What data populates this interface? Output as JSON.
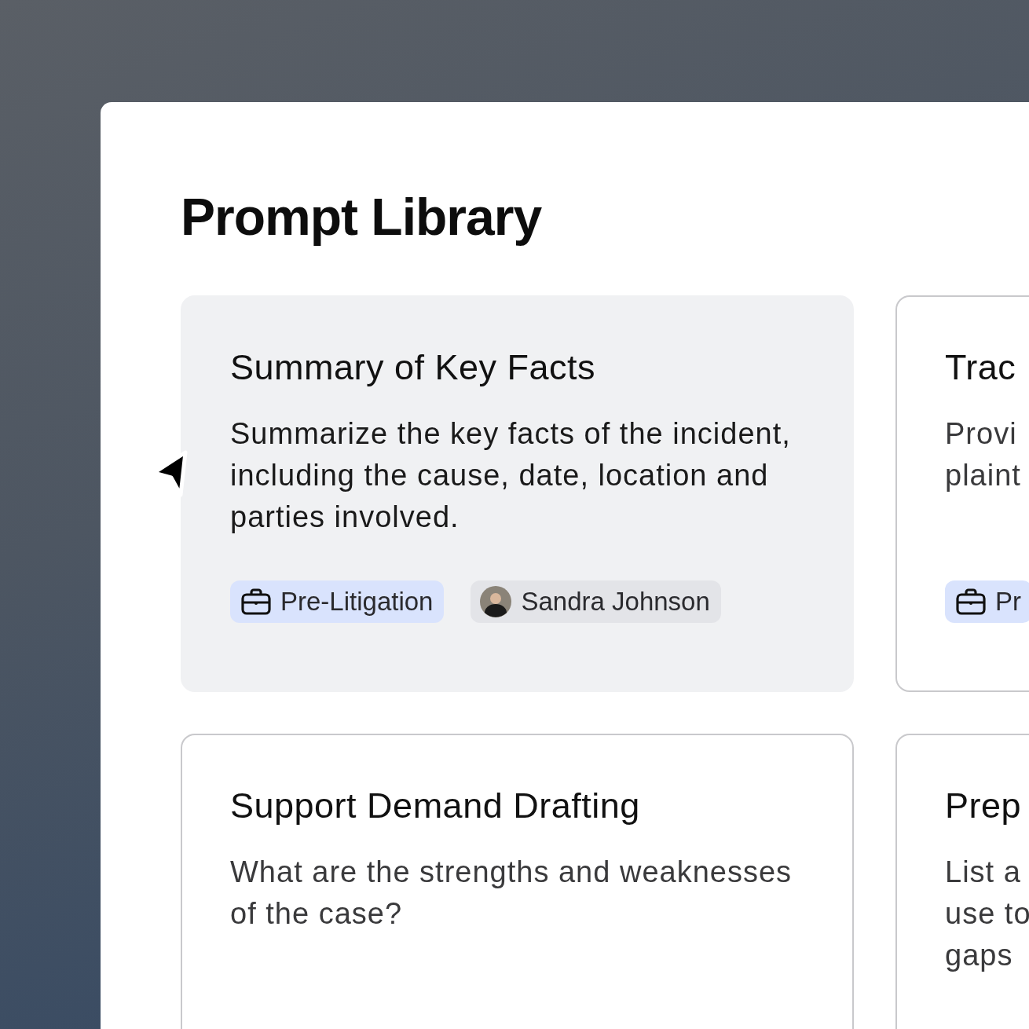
{
  "title": "Prompt Library",
  "cards": [
    {
      "title": "Summary of Key Facts",
      "description": "Summarize the key facts of the incident, including the cause, date, location and parties involved.",
      "highlighted": true,
      "tags": [
        {
          "kind": "category",
          "label": "Pre-Litigation"
        },
        {
          "kind": "author",
          "label": "Sandra Johnson"
        }
      ]
    },
    {
      "title": "Trac",
      "description": "Provi\nplaint",
      "highlighted": false,
      "tags": [
        {
          "kind": "category",
          "label": "Pr"
        }
      ]
    },
    {
      "title": "Support Demand Drafting",
      "description": "What are the strengths and weaknesses of the case?",
      "highlighted": false
    },
    {
      "title": "Prep",
      "description": "List a\nuse to\ngaps",
      "highlighted": false
    }
  ]
}
